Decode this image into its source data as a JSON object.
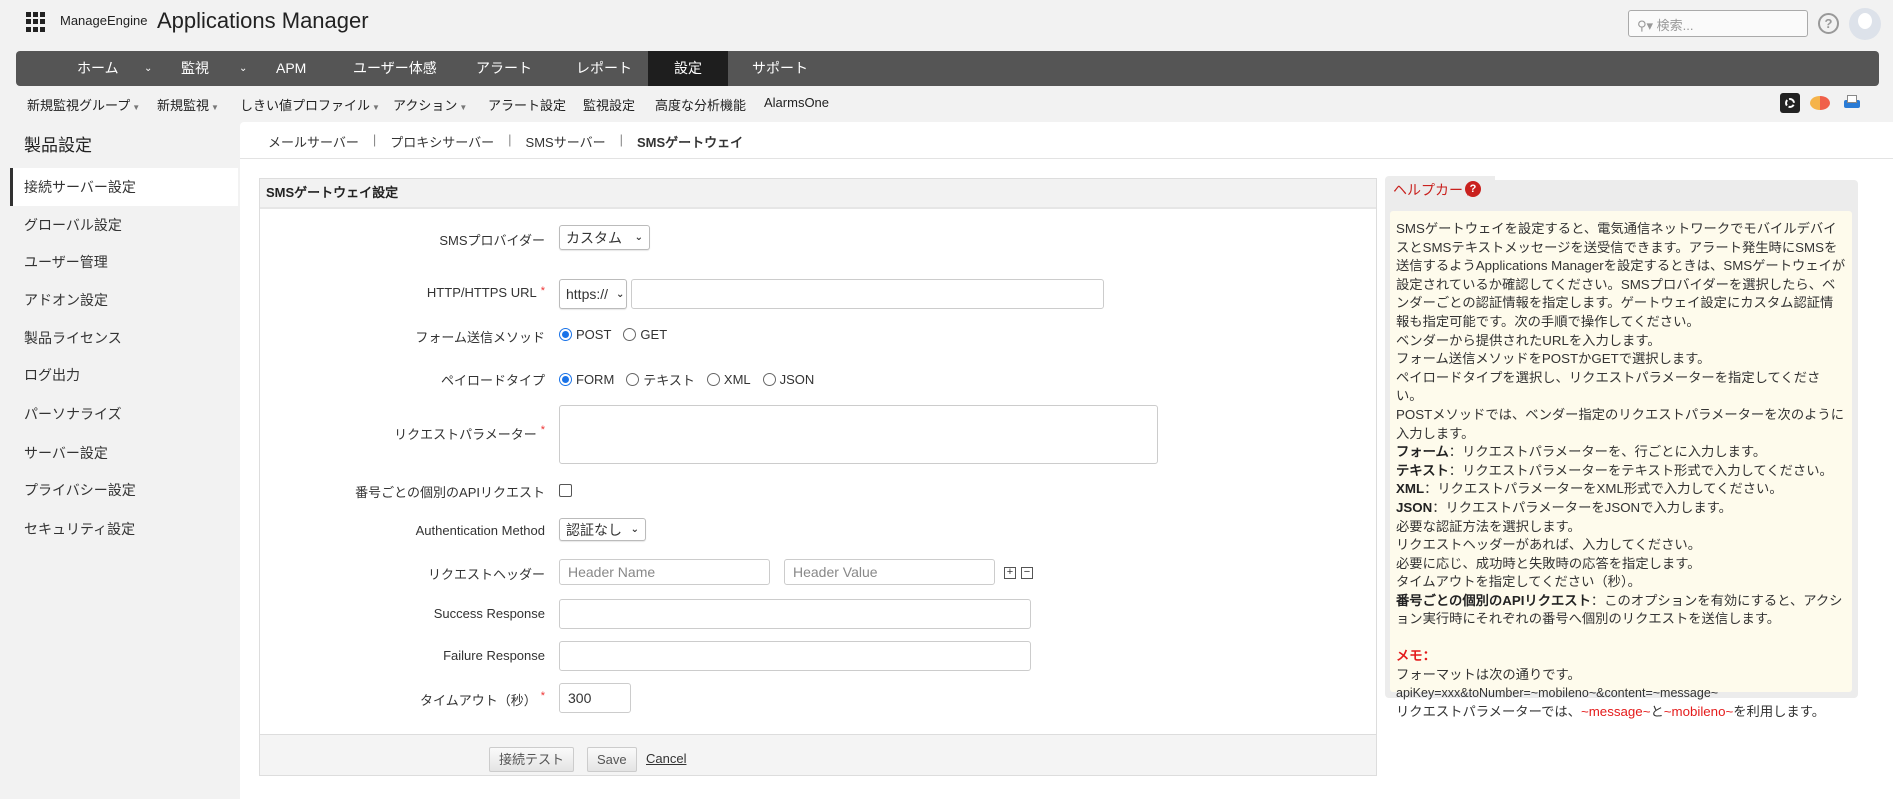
{
  "header": {
    "brand": "ManageEngine",
    "product": "Applications Manager",
    "search_placeholder": "検索...",
    "help_label": "?"
  },
  "nav": {
    "items": [
      {
        "label": "ホーム",
        "has_menu": true
      },
      {
        "label": "監視",
        "has_menu": true
      },
      {
        "label": "APM"
      },
      {
        "label": "ユーザー体感"
      },
      {
        "label": "アラート"
      },
      {
        "label": "レポート"
      },
      {
        "label": "設定",
        "active": true
      },
      {
        "label": "サポート"
      }
    ]
  },
  "subnav": {
    "items": [
      {
        "label": "新規監視グループ"
      },
      {
        "label": "新規監視"
      },
      {
        "label": "しきい値プロファイル"
      },
      {
        "label": "アクション"
      },
      {
        "label": "アラート設定"
      },
      {
        "label": "監視設定"
      },
      {
        "label": "高度な分析機能"
      },
      {
        "label": "AlarmsOne"
      }
    ]
  },
  "sidebar": {
    "title": "製品設定",
    "items": [
      {
        "label": "接続サーバー設定",
        "active": true
      },
      {
        "label": "グローバル設定"
      },
      {
        "label": "ユーザー管理"
      },
      {
        "label": "アドオン設定"
      },
      {
        "label": "製品ライセンス"
      },
      {
        "label": "ログ出力"
      },
      {
        "label": "パーソナライズ"
      },
      {
        "label": "サーバー設定"
      },
      {
        "label": "プライバシー設定"
      },
      {
        "label": "セキュリティ設定"
      }
    ]
  },
  "breadcrumb": {
    "items": [
      "メールサーバー",
      "プロキシサーバー",
      "SMSサーバー",
      "SMSゲートウェイ"
    ],
    "separator": "|"
  },
  "form": {
    "title": "SMSゲートウェイ設定",
    "provider_label": "SMSプロバイダー",
    "provider_value": "カスタム",
    "url_label": "HTTP/HTTPS URL",
    "url_scheme": "https://",
    "url_value": "",
    "method_label": "フォーム送信メソッド",
    "method_options": [
      "POST",
      "GET"
    ],
    "payload_label": "ペイロードタイプ",
    "payload_options": [
      "FORM",
      "テキスト",
      "XML",
      "JSON"
    ],
    "params_label": "リクエストパラメーター",
    "per_number_label": "番号ごとの個別のAPIリクエスト",
    "auth_label": "Authentication Method",
    "auth_value": "認証なし",
    "header_label": "リクエストヘッダー",
    "header_name_placeholder": "Header Name",
    "header_value_placeholder": "Header Value",
    "success_label": "Success Response",
    "failure_label": "Failure Response",
    "timeout_label": "タイムアウト（秒）",
    "timeout_value": "300",
    "required_mark": "*",
    "test_button": "接続テスト",
    "save_button": "Save",
    "cancel_link": "Cancel"
  },
  "help": {
    "title": "ヘルプカード",
    "intro": "SMSゲートウェイを設定すると、電気通信ネットワークでモバイルデバイスとSMSテキストメッセージを送受信できます。アラート発生時にSMSを送信するようApplications Managerを設定するときは、SMSゲートウェイが設定されているか確認してください。SMSプロバイダーを選択したら、ベンダーごとの認証情報を指定します。ゲートウェイ設定にカスタム認証情報も指定可能です。次の手順で操作してください。",
    "steps": [
      "ベンダーから提供されたURLを入力します。",
      "フォーム送信メソッドをPOSTかGETで選択します。",
      "ペイロードタイプを選択し、リクエストパラメーターを指定してください。",
      "POSTメソッドでは、ベンダー指定のリクエストパラメーターを次のように入力します。"
    ],
    "types": [
      {
        "term": "フォーム",
        "desc": "：リクエストパラメーターを、行ごとに入力します。"
      },
      {
        "term": "テキスト",
        "desc": "：リクエストパラメーターをテキスト形式で入力してください。"
      },
      {
        "term": "XML",
        "desc": "：リクエストパラメーターをXML形式で入力してください。"
      },
      {
        "term": "JSON",
        "desc": "：リクエストパラメーターをJSONで入力します。"
      }
    ],
    "steps2": [
      "必要な認証方法を選択します。",
      "リクエストヘッダーがあれば、入力してください。",
      "必要に応じ、成功時と失敗時の応答を指定します。",
      "タイムアウトを指定してください（秒）。"
    ],
    "per_number_term": "番号ごとの個別のAPIリクエスト",
    "per_number_desc": "：このオプションを有効にすると、アクション実行時にそれぞれの番号へ個別のリクエストを送信します。",
    "memo_title": "メモ：",
    "memo_format": "フォーマットは次の通りです。",
    "memo_example": "apiKey=xxx&toNumber=~mobileno~&content=~message~",
    "memo_usage_pre": "リクエストパラメーターでは、",
    "memo_var1": "~message~",
    "memo_and": "と",
    "memo_var2": "~mobileno~",
    "memo_usage_post": "を利用します。"
  }
}
